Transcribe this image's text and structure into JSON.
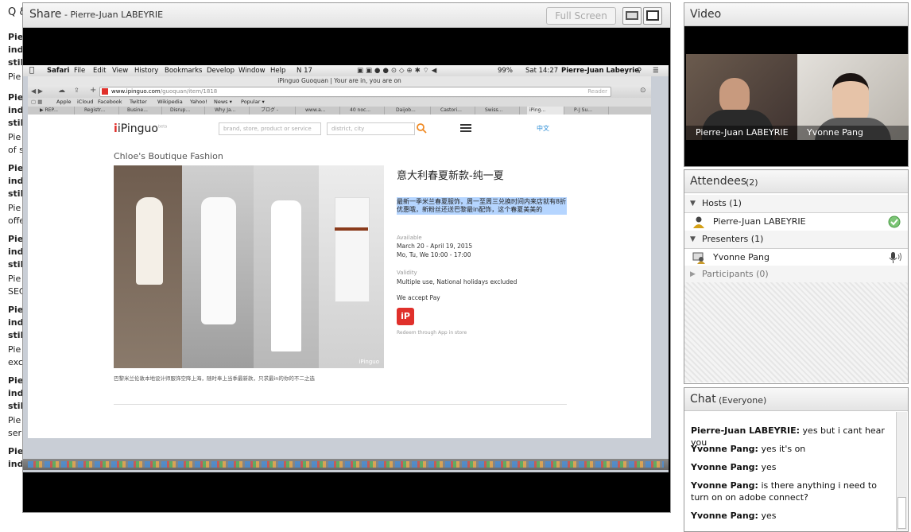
{
  "background": {
    "left_items": [
      "Q &",
      "Pie",
      "ind",
      "stil",
      "Pie",
      "Pie",
      "ind",
      "stil",
      "Pie",
      "of s",
      "Pie",
      "ind",
      "stil",
      "Pie",
      "offe",
      "Pie",
      "ind",
      "stil",
      "Pie",
      "SEC",
      "Pie",
      "ind",
      "stil",
      "Pie",
      "exc",
      "Pie",
      "ind",
      "stil",
      "Pie",
      "ser",
      "Pie",
      "ind"
    ]
  },
  "share": {
    "title": "Share",
    "presenter": "- Pierre-Juan LABEYRIE",
    "fullscreen_label": "Full Screen",
    "mac": {
      "menubar": {
        "app": "Safari",
        "items": [
          "File",
          "Edit",
          "View",
          "History",
          "Bookmarks",
          "Develop",
          "Window",
          "Help"
        ],
        "status_left": "17",
        "battery": "99%",
        "clock": "Sat 14:27",
        "user": "Pierre-Juan Labeyrie"
      },
      "safari": {
        "window_title": "iPinguo Guoquan | Your are in, you are on",
        "url_domain": "www.ipinguo.com",
        "url_path": "/guoquan/item/1818",
        "reader_label": "Reader",
        "bookmarks": [
          "Apple",
          "iCloud",
          "Facebook",
          "Twitter",
          "Wikipedia",
          "Yahoo!",
          "News ▾",
          "Popular ▾"
        ],
        "tabs": [
          "▶ REP...",
          "Registr...",
          "Busine...",
          "Disrup...",
          "Why Ja...",
          "ブログ -",
          "www.a...",
          "40 noc...",
          "Daijob...",
          "Castori...",
          "Swiss...",
          "iPing...",
          "P-J Su..."
        ]
      },
      "page": {
        "logo": "iPinguo",
        "logo_beta": "beta",
        "search_placeholder": "brand, store, product or service",
        "district_placeholder": "district, city",
        "lang": "中文",
        "store_name": "Chloe's Boutique Fashion",
        "product_title": "意大利春夏新款-纯一夏",
        "product_desc": "最新一季米兰春夏服饰，周一至周三兑换时间内来店就有8折优惠哦，新粉丝还送巴黎最in配饰，这个春夏美美的",
        "available_label": "Available",
        "available_dates": "March 20 - April 19, 2015",
        "available_times": "Mo, Tu, We 10:00 - 17:00",
        "validity_label": "Validity",
        "validity_value": "Multiple use, National holidays excluded",
        "accept_text": "We accept Pay",
        "badge": "iP",
        "redeem_text": "Redeem through App in store",
        "photo_watermark": "iPinguo",
        "caption": "巴黎米兰伦敦本地设计师服饰空降上海，随时奉上当季最新款，只求最in的你的不二之选"
      }
    }
  },
  "video": {
    "title": "Video",
    "participants": [
      {
        "name": "Pierre-Juan LABEYRIE"
      },
      {
        "name": "Yvonne Pang"
      }
    ]
  },
  "attendees": {
    "title": "Attendees",
    "count": "(2)",
    "hosts_label": "Hosts (1)",
    "host_name": "Pierre-Juan LABEYRIE",
    "presenters_label": "Presenters (1)",
    "presenter_name": "Yvonne Pang",
    "participants_label": "Participants (0)"
  },
  "chat": {
    "title": "Chat",
    "scope": "(Everyone)",
    "messages": [
      {
        "sender": "Pierre-Juan LABEYRIE:",
        "text": "yes but i cant hear you"
      },
      {
        "sender": "Yvonne Pang:",
        "text": "yes it's on"
      },
      {
        "sender": "Yvonne Pang:",
        "text": "yes"
      },
      {
        "sender": "Yvonne Pang:",
        "text": "is there anything i need to turn on on adobe connect?"
      },
      {
        "sender": "Yvonne Pang:",
        "text": "yes"
      }
    ]
  },
  "colors": {
    "accent_red": "#e0302b",
    "selection_blue": "#b5d5ff",
    "host_status_green": "#4caf50"
  }
}
